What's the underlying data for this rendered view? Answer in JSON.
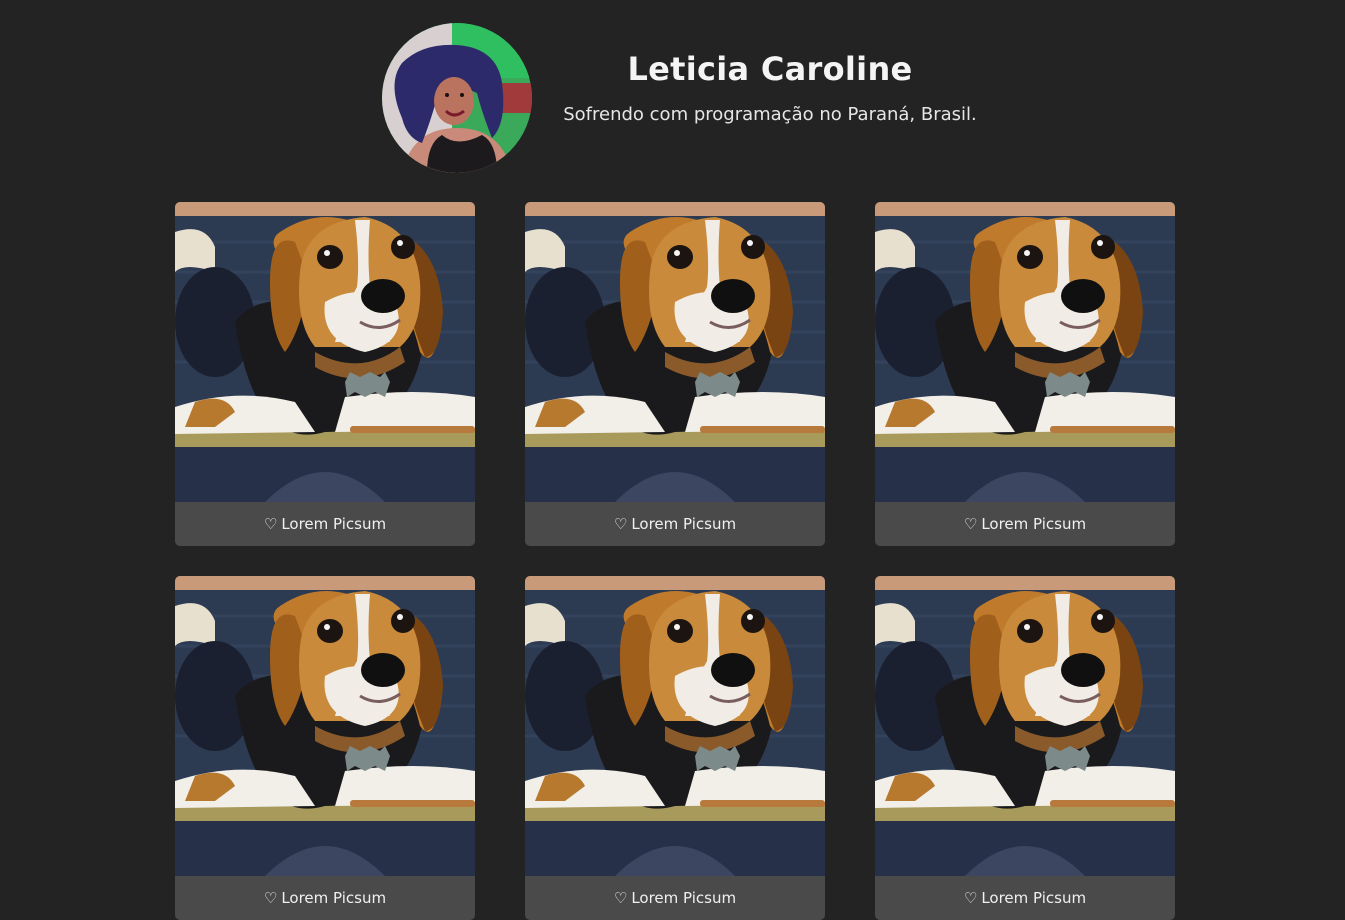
{
  "profile": {
    "name": "Leticia Caroline",
    "bio": "Sofrendo com programação no Paraná, Brasil."
  },
  "cards": [
    {
      "caption": "Lorem Picsum",
      "like_icon": "♡"
    },
    {
      "caption": "Lorem Picsum",
      "like_icon": "♡"
    },
    {
      "caption": "Lorem Picsum",
      "like_icon": "♡"
    },
    {
      "caption": "Lorem Picsum",
      "like_icon": "♡"
    },
    {
      "caption": "Lorem Picsum",
      "like_icon": "♡"
    },
    {
      "caption": "Lorem Picsum",
      "like_icon": "♡"
    }
  ],
  "colors": {
    "background": "#232323",
    "card_caption_bg": "#4a4a4a",
    "text": "#f2f2f2"
  }
}
